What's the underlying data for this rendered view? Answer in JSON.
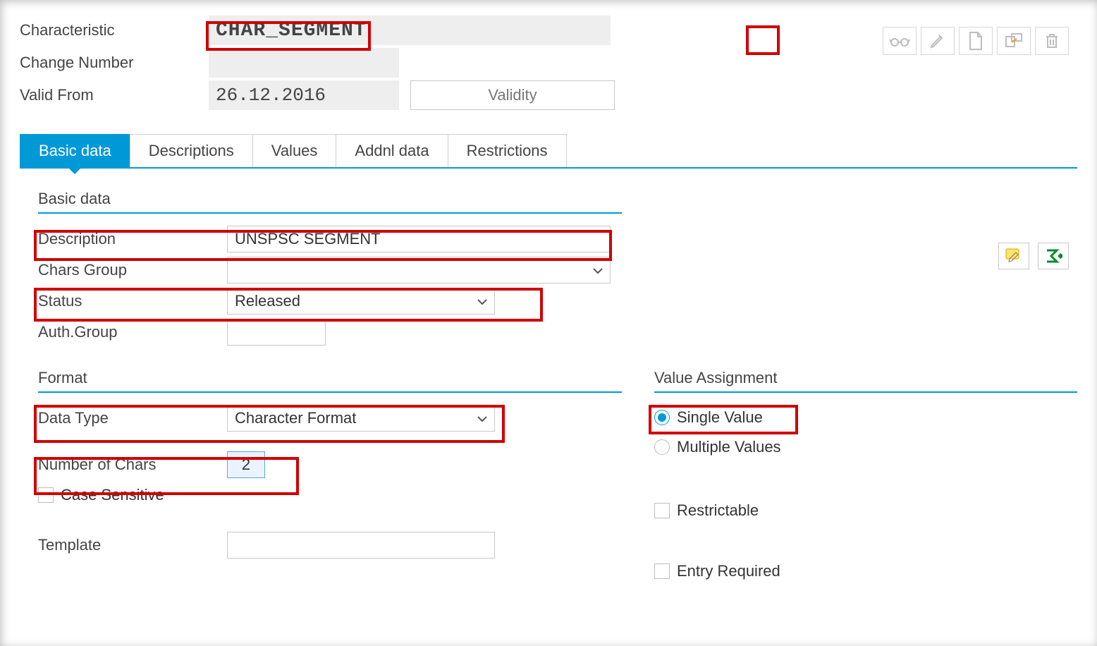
{
  "header": {
    "labels": {
      "characteristic": "Characteristic",
      "change_number": "Change Number",
      "valid_from": "Valid From"
    },
    "values": {
      "characteristic": "CHAR_SEGMENT",
      "change_number": "",
      "valid_from": "26.12.2016"
    },
    "validity_button": "Validity"
  },
  "toolbar_icons": [
    "display",
    "edit",
    "create",
    "other",
    "delete"
  ],
  "tabs": [
    {
      "id": "basic",
      "label": "Basic data",
      "active": true
    },
    {
      "id": "desc",
      "label": "Descriptions",
      "active": false
    },
    {
      "id": "values",
      "label": "Values",
      "active": false
    },
    {
      "id": "addn",
      "label": "Addnl data",
      "active": false
    },
    {
      "id": "restr",
      "label": "Restrictions",
      "active": false
    }
  ],
  "basic_data": {
    "panel_title": "Basic data",
    "labels": {
      "description": "Description",
      "chars_group": "Chars Group",
      "status": "Status",
      "auth_group": "Auth.Group"
    },
    "values": {
      "description": "UNSPSC SEGMENT",
      "chars_group": "",
      "status": "Released",
      "auth_group": ""
    }
  },
  "format": {
    "panel_title": "Format",
    "labels": {
      "data_type": "Data Type",
      "number_of_chars": "Number of Chars",
      "case_sensitive": "Case Sensitive",
      "template": "Template"
    },
    "values": {
      "data_type": "Character Format",
      "number_of_chars": "2",
      "case_sensitive": false,
      "template": ""
    }
  },
  "value_assignment": {
    "panel_title": "Value Assignment",
    "labels": {
      "single_value": "Single Value",
      "multiple_values": "Multiple Values",
      "restrictable": "Restrictable",
      "entry_required": "Entry Required"
    },
    "values": {
      "selected": "single",
      "restrictable": false,
      "entry_required": false
    }
  }
}
